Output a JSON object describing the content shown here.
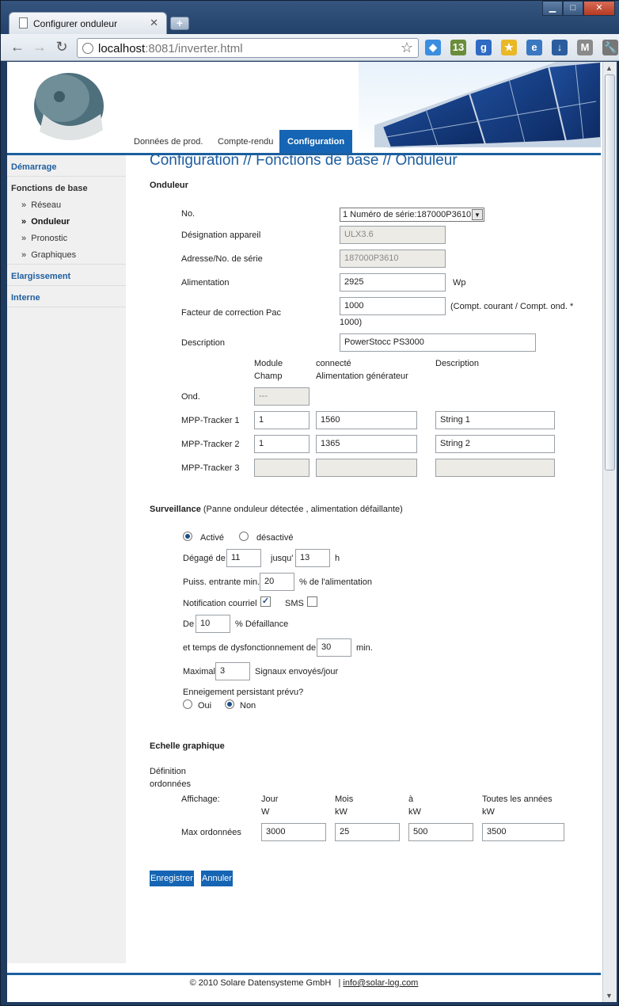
{
  "browser": {
    "tab_title": "Configurer onduleur",
    "tab_close": "✕",
    "new_tab": "+",
    "url_host": "localhost",
    "url_path": ":8081/inverter.html",
    "back": "←",
    "forward": "→",
    "reload": "↻",
    "bookmark_star": "☆",
    "window_minimize": "▁",
    "window_maximize": "□",
    "window_close": "✕",
    "extensions": [
      {
        "icon": "dropbox-icon",
        "text": "◆",
        "color": "#3b8de0"
      },
      {
        "icon": "calendar-badge-icon",
        "text": "13",
        "color": "#6a8d3a"
      },
      {
        "icon": "google-icon",
        "text": "g",
        "color": "#2f6ac4"
      },
      {
        "icon": "star-icon",
        "text": "★",
        "color": "#e9b825"
      },
      {
        "icon": "ie-tab-icon",
        "text": "e",
        "color": "#3a78c2"
      },
      {
        "icon": "download-icon",
        "text": "↓",
        "color": "#2b5d9e"
      },
      {
        "icon": "gmail-icon",
        "text": "M",
        "color": "#8a8a8a"
      },
      {
        "icon": "wrench-icon",
        "text": "🔧",
        "color": "#777777"
      }
    ]
  },
  "nav": {
    "tabs": [
      {
        "label": "Données de prod.",
        "active": false
      },
      {
        "label": "Compte-rendu",
        "active": false
      },
      {
        "label": "Configuration",
        "active": true
      }
    ]
  },
  "sidebar": {
    "demarrage": "Démarrage",
    "fonctions": "Fonctions de base",
    "items": [
      {
        "label": "Réseau",
        "bullet": "»"
      },
      {
        "label": "Onduleur",
        "bullet": "»"
      },
      {
        "label": "Pronostic",
        "bullet": "»"
      },
      {
        "label": "Graphiques",
        "bullet": "»"
      }
    ],
    "elargissement": "Elargissement",
    "interne": "Interne"
  },
  "page": {
    "title": "Configuration // Fonctions de base // Onduleur",
    "section_onduleur": "Onduleur",
    "no_label": "No.",
    "no_value": "1 Numéro de série:187000P3610",
    "designation_label": "Désignation appareil",
    "designation_value": "ULX3.6",
    "adresse_label": "Adresse/No. de série",
    "adresse_value": "187000P3610",
    "alimentation_label": "Alimentation",
    "alimentation_value": "2925",
    "alimentation_unit": "Wp",
    "facteur_label": "Facteur de correction Pac",
    "facteur_value": "1000",
    "facteur_hint_1": "(Compt. courant / Compt. ond. *",
    "facteur_hint_2": "1000)",
    "description_label": "Description",
    "description_value": "PowerStocc PS3000",
    "col_module_1": "Module",
    "col_module_2": "Champ",
    "col_connecte_1": "connecté",
    "col_connecte_2": "Alimentation générateur",
    "col_description": "Description",
    "ond_label": "Ond.",
    "ond_module_value": "---",
    "trackers": [
      {
        "label": "MPP-Tracker 1",
        "module": "1",
        "power": "1560",
        "desc": "String 1",
        "disabled": false
      },
      {
        "label": "MPP-Tracker 2",
        "module": "1",
        "power": "1365",
        "desc": "String 2",
        "disabled": false
      },
      {
        "label": "MPP-Tracker 3",
        "module": "",
        "power": "",
        "desc": "",
        "disabled": true
      }
    ]
  },
  "surveillance": {
    "title": "Surveillance",
    "subtitle": "(Panne onduleur détectée , alimentation défaillante)",
    "active_label": "Activé",
    "inactive_label": "désactivé",
    "active": true,
    "degage_label": "Dégagé de",
    "degage_from": "11",
    "jusqu_label": "jusqu'",
    "degage_to": "13",
    "hour_unit": "h",
    "puiss_label": "Puiss. entrante min.",
    "puiss_value": "20",
    "puiss_unit": "% de l'alimentation",
    "notif_label": "Notification courriel",
    "notif_checked": true,
    "sms_label": "SMS",
    "sms_checked": false,
    "check_mark": "✓",
    "de_label": "De",
    "de_value": "10",
    "de_unit": "% Défaillance",
    "temps_label": "et temps de dysfonctionnement de",
    "temps_value": "30",
    "temps_unit": "min.",
    "maximal_label": "Maximal",
    "maximal_value": "3",
    "maximal_unit": "Signaux envoyés/jour",
    "enneigement_label": "Enneigement persistant prévu?",
    "oui_label": "Oui",
    "non_label": "Non",
    "enneigement": "Non"
  },
  "echelle": {
    "title": "Echelle graphique",
    "definition_1": "Définition",
    "definition_2": "ordonnées",
    "affichage_label": "Affichage:",
    "cols": [
      {
        "name": "Jour",
        "unit": "W",
        "value": "3000"
      },
      {
        "name": "Mois",
        "unit": "kW",
        "value": "25"
      },
      {
        "name": "à",
        "unit": "kW",
        "value": "500"
      },
      {
        "name": "Toutes les années",
        "unit": "kW",
        "value": "3500"
      }
    ],
    "max_label": "Max ordonnées"
  },
  "buttons": {
    "save": "Enregistrer",
    "cancel": "Annuler"
  },
  "footer": {
    "copyright": "© 2010 Solare Datensysteme GmbH",
    "separator": "|",
    "email": "info@solar-log.com"
  }
}
